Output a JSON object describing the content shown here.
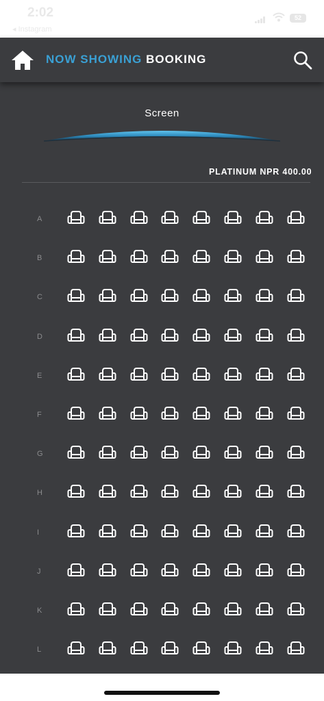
{
  "status_bar": {
    "time": "2:02",
    "back_app": "◂ Instagram",
    "battery": "52"
  },
  "header": {
    "title_accent": "NOW SHOWING",
    "title_main": "BOOKING",
    "home_icon": "home-icon",
    "search_icon": "search-icon"
  },
  "seat_map": {
    "screen_label": "Screen",
    "price_label": "PLATINUM NPR 400.00",
    "rows": [
      "A",
      "B",
      "C",
      "D",
      "E",
      "F",
      "G",
      "H",
      "I",
      "J",
      "K",
      "L"
    ],
    "seats_per_row": 8,
    "seat_icon": "seat-icon",
    "seat_status": "available"
  },
  "colors": {
    "background": "#3b3c3f",
    "accent": "#3aa0d4",
    "seat": "#ffffff",
    "row_label": "#8b8c8e"
  }
}
